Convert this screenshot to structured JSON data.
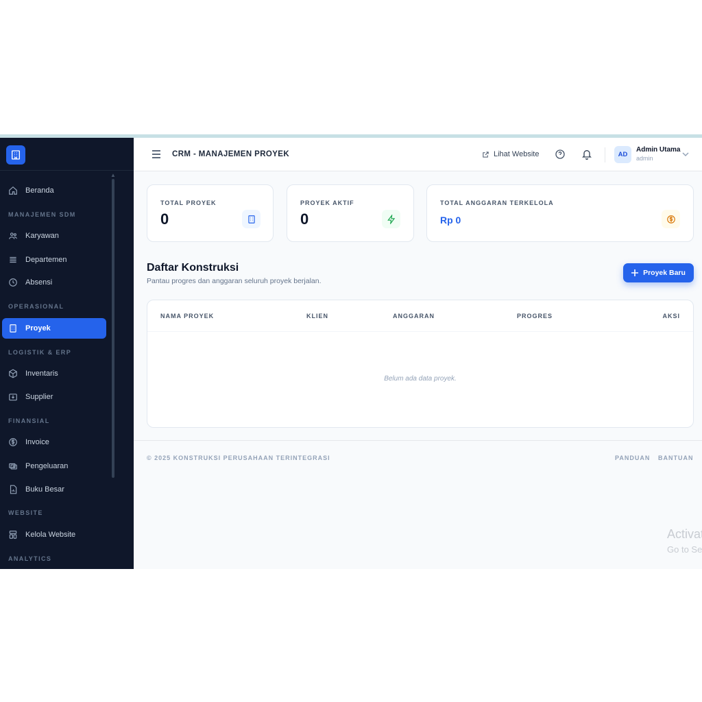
{
  "sidebar": {
    "items": [
      {
        "label": "Beranda",
        "icon": "home-icon"
      },
      {
        "label": "Karyawan",
        "icon": "users-icon"
      },
      {
        "label": "Departemen",
        "icon": "list-icon"
      },
      {
        "label": "Absensi",
        "icon": "clock-icon"
      },
      {
        "label": "Proyek",
        "icon": "building-icon",
        "active": true
      },
      {
        "label": "Inventaris",
        "icon": "box-icon"
      },
      {
        "label": "Supplier",
        "icon": "inbox-icon"
      },
      {
        "label": "Invoice",
        "icon": "dollar-circle-icon"
      },
      {
        "label": "Pengeluaran",
        "icon": "money-icon"
      },
      {
        "label": "Buku Besar",
        "icon": "file-chart-icon"
      },
      {
        "label": "Kelola Website",
        "icon": "layout-icon"
      }
    ],
    "sections": [
      "MANAJEMEN SDM",
      "OPERASIONAL",
      "LOGISTIK & ERP",
      "FINANSIAL",
      "WEBSITE",
      "ANALYTICS"
    ]
  },
  "header": {
    "title": "CRM - MANAJEMEN PROYEK",
    "visit_label": "Lihat Website",
    "user": {
      "initials": "AD",
      "name": "Admin Utama",
      "role": "admin"
    }
  },
  "stats": [
    {
      "label": "TOTAL PROYEK",
      "value": "0",
      "icon": "building-icon"
    },
    {
      "label": "PROYEK AKTIF",
      "value": "0",
      "icon": "lightning-icon"
    },
    {
      "label": "TOTAL ANGGARAN TERKELOLA",
      "value": "Rp 0",
      "icon": "dollar-circle-icon"
    }
  ],
  "section": {
    "title": "Daftar Konstruksi",
    "subtitle": "Pantau progres dan anggaran seluruh proyek berjalan.",
    "add_label": "Proyek Baru"
  },
  "table": {
    "columns": [
      "NAMA PROYEK",
      "KLIEN",
      "ANGGARAN",
      "PROGRES",
      "AKSI"
    ],
    "empty": "Belum ada data proyek."
  },
  "footer": {
    "copyright": "© 2025 KONSTRUKSI PERUSAHAAN TERINTEGRASI",
    "links": [
      "PANDUAN",
      "BANTUAN"
    ]
  },
  "watermark": {
    "line1": "Activat",
    "line2": "Go to Se"
  },
  "colors": {
    "sidebar_bg": "#0f172a",
    "accent": "#2563eb",
    "page_bg": "#f8fafc"
  }
}
